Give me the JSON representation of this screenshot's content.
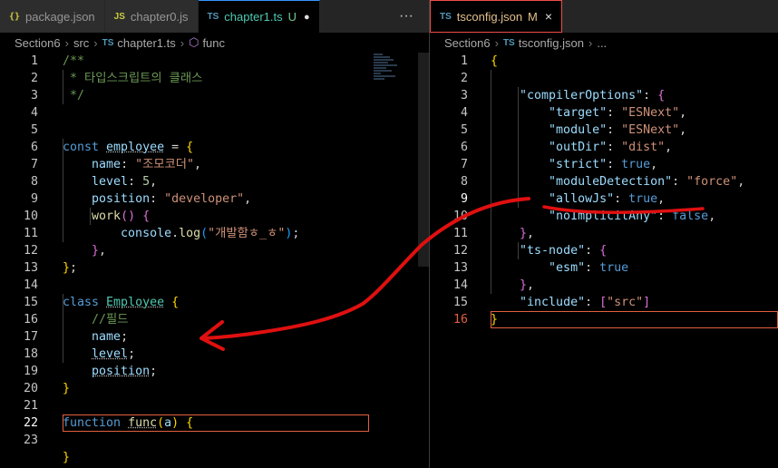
{
  "left": {
    "tabs": [
      {
        "icon_label": "{}",
        "label": "package.json",
        "active": false
      },
      {
        "icon_label": "JS",
        "label": "chapter0.js",
        "active": false
      },
      {
        "icon_label": "TS",
        "label": "chapter1.ts",
        "badge": "U",
        "active": true
      }
    ],
    "more_label": "···",
    "breadcrumb": [
      "Section6",
      "src",
      "chapter1.ts",
      "func"
    ],
    "breadcrumb_ts_icon": "TS",
    "line_numbers": [
      "1",
      "2",
      "3",
      "4",
      "5",
      "6",
      "7",
      "8",
      "9",
      "10",
      "11",
      "12",
      "13",
      "14",
      "15",
      "16",
      "17",
      "18",
      "19",
      "20",
      "21",
      "22",
      "23"
    ],
    "code": {
      "l1": "/**",
      "l2": " * 타입스크립트의 클래스",
      "l3": " */",
      "l5_kw": "const",
      "l5_var": "employee",
      "l5_rest": " = ",
      "l5_br": "{",
      "l6_key": "name",
      "l6_str": "\"조모코더\"",
      "l7_key": "level",
      "l7_num": "5",
      "l8_key": "position",
      "l8_str": "\"developer\"",
      "l9_fn": "work",
      "l10_obj": "console",
      "l10_fn": "log",
      "l10_str": "\"개발함ㅎ_ㅎ\"",
      "l14_kw": "class",
      "l14_cls": "Employee",
      "l15_cmt": "//필드",
      "l16_var": "name",
      "l17_var": "level",
      "l18_var": "position",
      "l21_kw": "function",
      "l21_fn": "func",
      "l21_param": "a"
    }
  },
  "right": {
    "tab": {
      "icon_label": "TS",
      "label": "tsconfig.json",
      "badge": "M",
      "close_icon": "×"
    },
    "breadcrumb": [
      "Section6",
      "tsconfig.json",
      "..."
    ],
    "line_numbers": [
      "1",
      "2",
      "3",
      "4",
      "5",
      "6",
      "7",
      "8",
      "9",
      "10",
      "11",
      "12",
      "13",
      "14",
      "15",
      "16"
    ],
    "code": {
      "compilerOptions": "\"compilerOptions\"",
      "target_k": "\"target\"",
      "target_v": "\"ESNext\"",
      "module_k": "\"module\"",
      "module_v": "\"ESNext\"",
      "outDir_k": "\"outDir\"",
      "outDir_v": "\"dist\"",
      "strict_k": "\"strict\"",
      "strict_v": "true",
      "moduleDetection_k": "\"moduleDetection\"",
      "moduleDetection_v": "\"force\"",
      "allowJs_k": "\"allowJs\"",
      "allowJs_v": "true",
      "noImplicitAny_k": "\"noImplicitAny\"",
      "noImplicitAny_v": "false",
      "tsnode_k": "\"ts-node\"",
      "esm_k": "\"esm\"",
      "esm_v": "true",
      "include_k": "\"include\"",
      "include_v": "\"src\""
    }
  },
  "annotation_color": "#e01010"
}
